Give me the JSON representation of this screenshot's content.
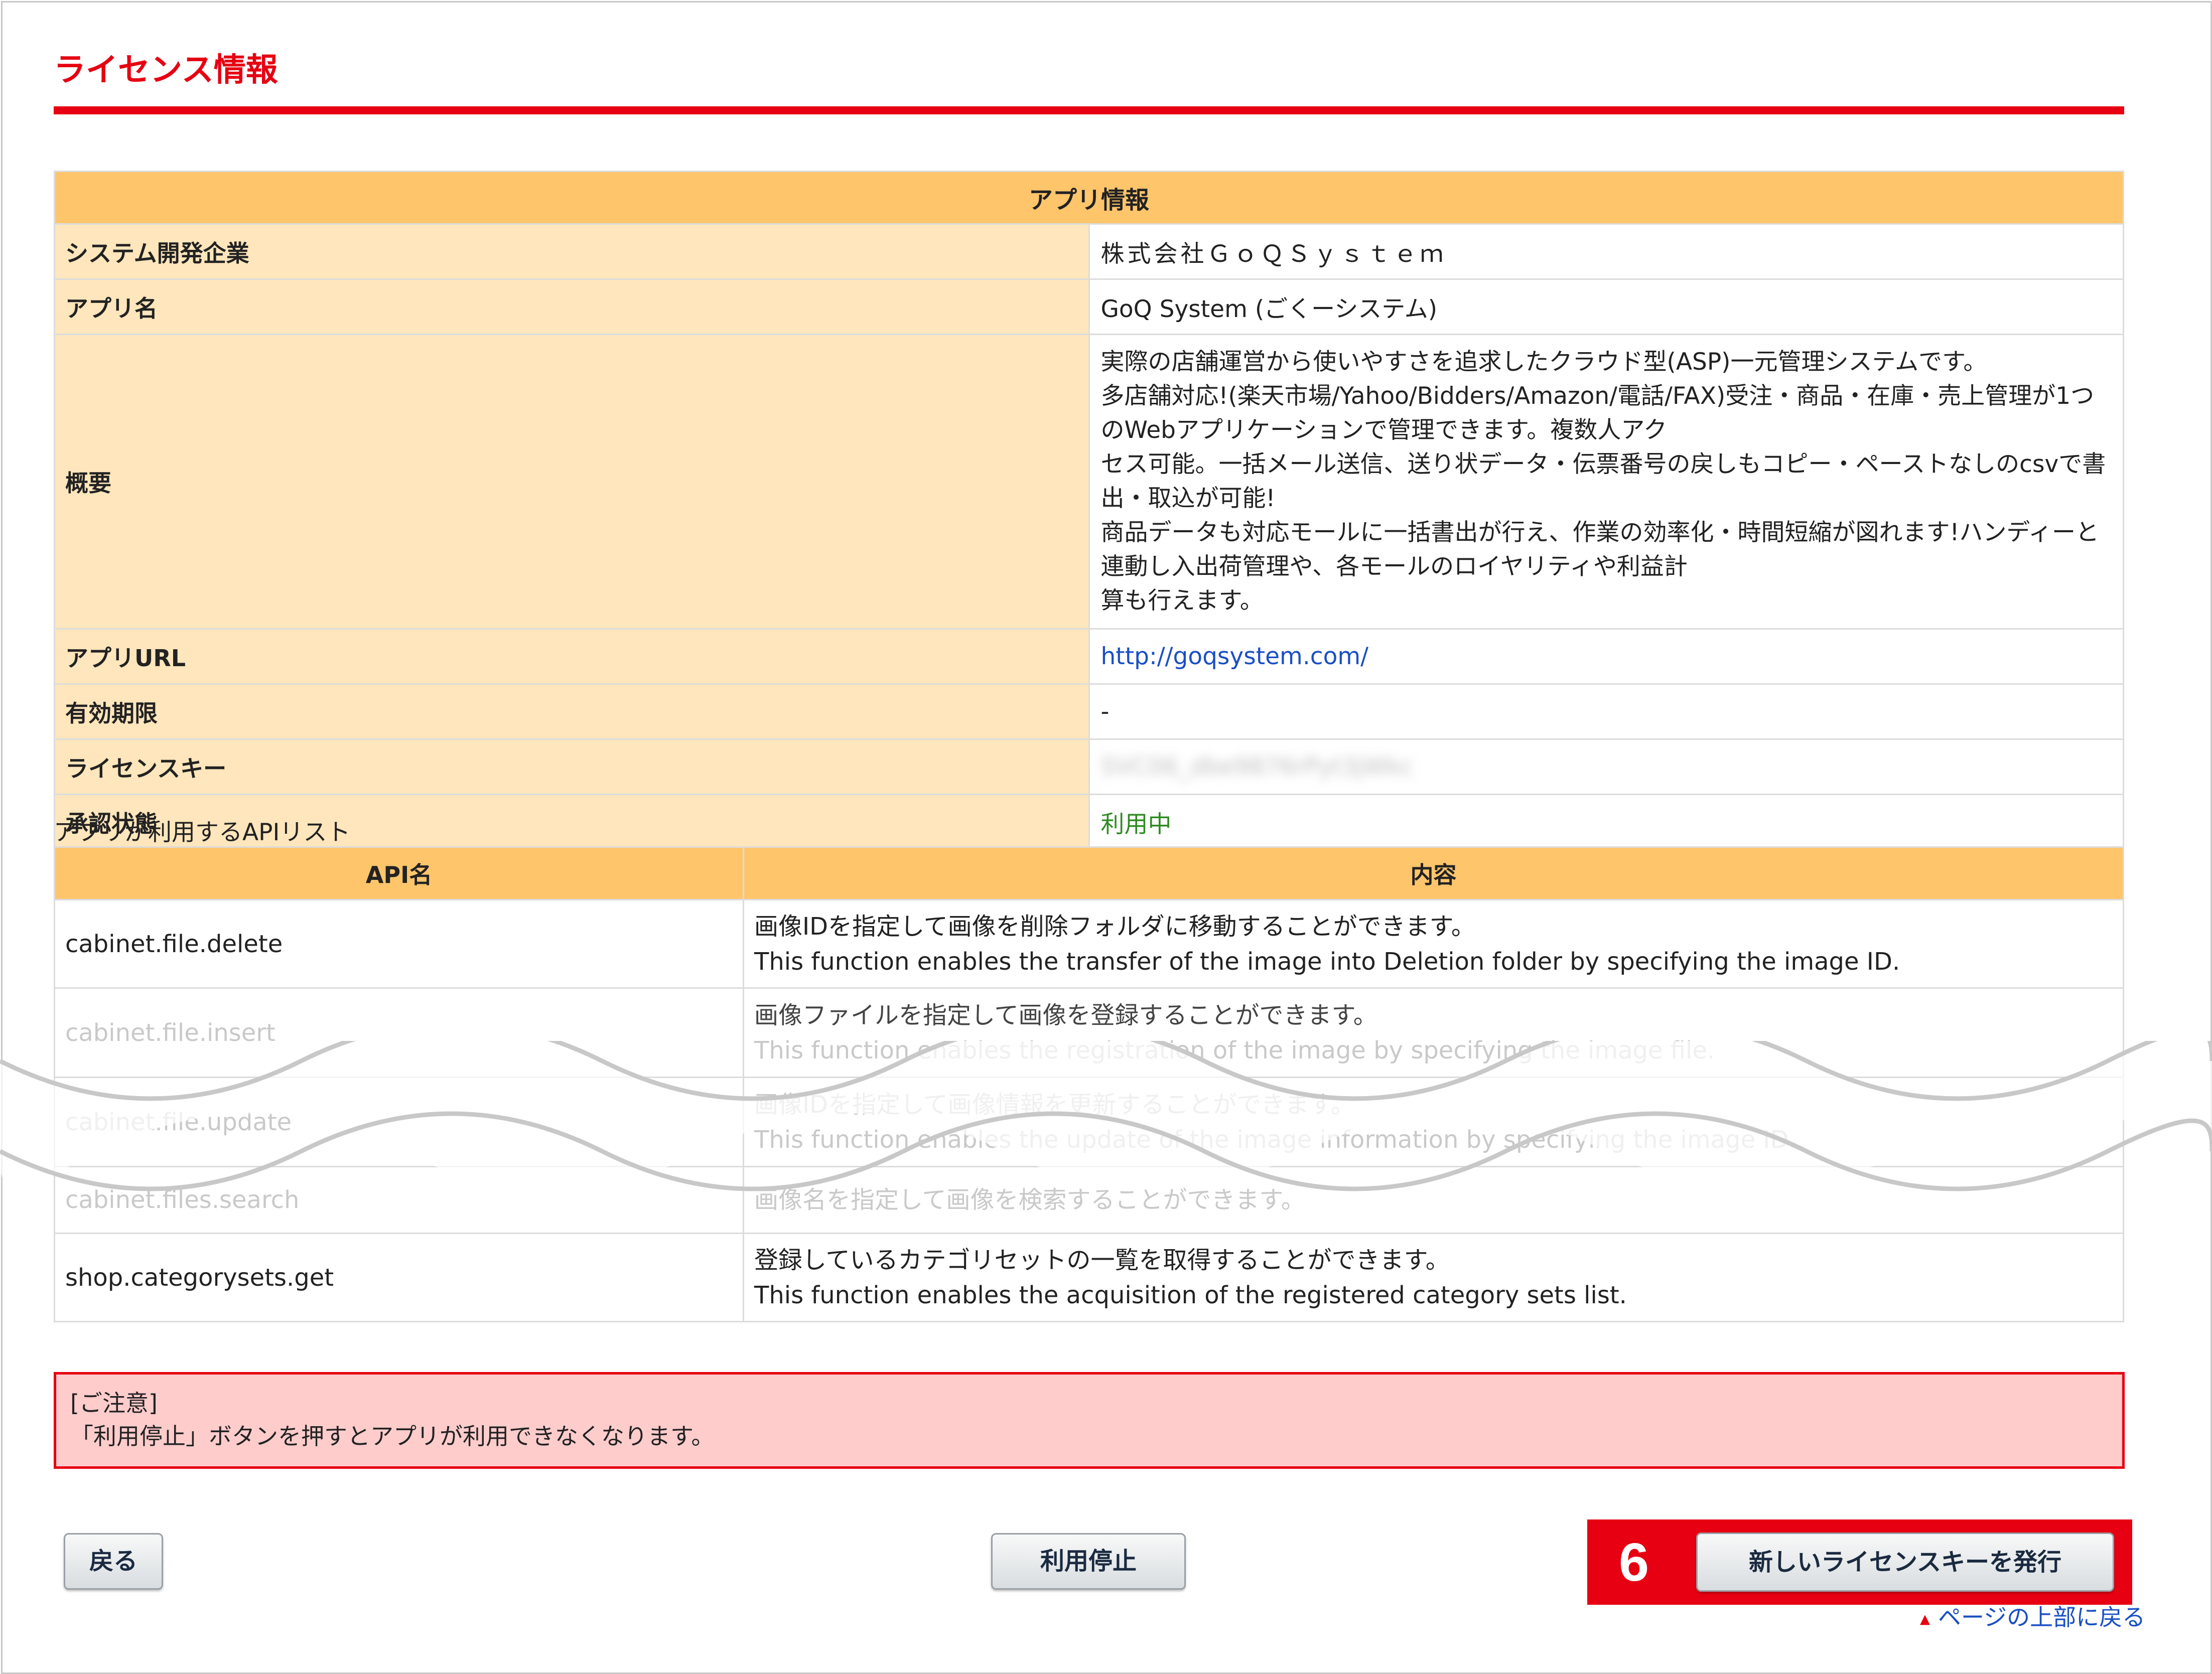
{
  "page_title": "ライセンス情報",
  "app_info": {
    "header": "アプリ情報",
    "rows": [
      {
        "label": "システム開発企業",
        "value": "株式会社ＧｏＱＳｙｓｔｅｍ"
      },
      {
        "label": "アプリ名",
        "value": "GoQ System (ごくーシステム)"
      },
      {
        "label": "概要",
        "lines": [
          "実際の店舗運営から使いやすさを追求したクラウド型(ASP)一元管理システムです。",
          "多店舗対応!(楽天市場/Yahoo/Bidders/Amazon/電話/FAX)受注・商品・在庫・売上管理が1つのWebアプリケーションで管理できます。複数人アク",
          "セス可能。一括メール送信、送り状データ・伝票番号の戻しもコピー・ペーストなしのcsvで書出・取込が可能!",
          "商品データも対応モールに一括書出が行え、作業の効率化・時間短縮が図れます!ハンディーと連動し入出荷管理や、各モールのロイヤリティや利益計",
          "算も行えます。"
        ]
      },
      {
        "label": "アプリURL",
        "value": "http://goqsystem.com/"
      },
      {
        "label": "有効期限",
        "value": "-"
      },
      {
        "label": "ライセンスキー",
        "value": "SVC06_dbe9876rPyt3jWkc"
      },
      {
        "label": "承認状態",
        "value": "利用中"
      }
    ]
  },
  "api_list": {
    "caption": "アプリが利用するAPIリスト",
    "col_name": "API名",
    "col_content": "内容",
    "rows": [
      {
        "name": "cabinet.file.delete",
        "ja": "画像IDを指定して画像を削除フォルダに移動することができます。",
        "en": "This function enables the transfer of the image into Deletion folder by specifying the image ID."
      },
      {
        "name": "cabinet.file.insert",
        "ja": "画像ファイルを指定して画像を登録することができます。",
        "en": "This function enables the registration of the image by specifying the image file."
      },
      {
        "name": "cabinet.file.update",
        "ja": "画像IDを指定して画像情報を更新することができます。",
        "en": "This function enables the update of the image information by specifying the image ID."
      },
      {
        "name": "cabinet.files.search",
        "ja": "画像名を指定して画像を検索することができます。",
        "en": ""
      },
      {
        "name": "shop.categorysets.get",
        "ja": "登録しているカテゴリセットの一覧を取得することができます。",
        "en": "This function enables the acquisition of the registered category sets list."
      }
    ]
  },
  "notice": {
    "title": "[ご注意]",
    "text": "「利用停止」ボタンを押すとアプリが利用できなくなります。"
  },
  "buttons": {
    "back": "戻る",
    "stop": "利用停止",
    "new_key": "新しいライセンスキーを発行"
  },
  "step_number": "6",
  "to_top": "ページの上部に戻る",
  "colors": {
    "accent_red": "#e60012",
    "header_orange": "#ffc56b",
    "label_bg": "#ffe6bc",
    "notice_bg": "#ffcccc",
    "link_blue": "#1a4fc4",
    "status_green": "#2e8b22"
  }
}
